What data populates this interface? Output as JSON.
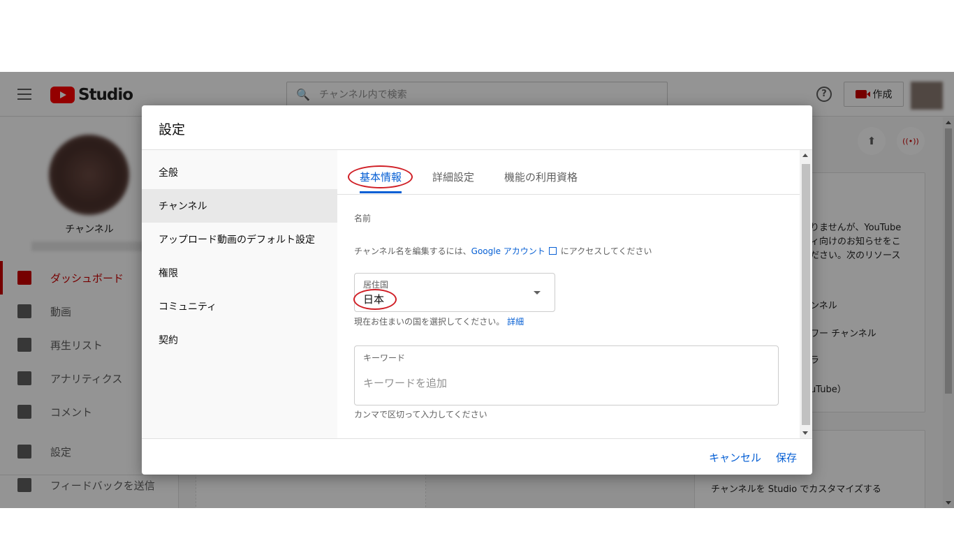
{
  "app": {
    "logo_text": "Studio",
    "search_placeholder": "チャンネル内で検索",
    "help_icon": "?",
    "create_label": "作成",
    "search_icon_glyph": "🔍"
  },
  "sidebar": {
    "channel_label": "チャンネル",
    "items": [
      {
        "label": "ダッシュボード",
        "icon": "dashboard-icon",
        "active": true
      },
      {
        "label": "動画",
        "icon": "video-icon"
      },
      {
        "label": "再生リスト",
        "icon": "playlist-icon"
      },
      {
        "label": "アナリティクス",
        "icon": "analytics-icon"
      },
      {
        "label": "コメント",
        "icon": "comment-icon"
      },
      {
        "label": "設定",
        "icon": "gear-icon"
      },
      {
        "label": "フィードバックを送信",
        "icon": "feedback-icon"
      }
    ]
  },
  "right_panel": {
    "upload_glyph": "⬆",
    "live_glyph": "((•))",
    "card_lines": [
      "りませんが、YouTube",
      "ィ向けのお知らせをこ",
      "ださい。次のリソース",
      "ンネル",
      "ワー チャンネル",
      "ラ",
      "uTube）"
    ],
    "bottom_card_text": "チャンネルを Studio でカスタマイズする"
  },
  "dialog": {
    "title": "設定",
    "nav": [
      "全般",
      "チャンネル",
      "アップロード動画のデフォルト設定",
      "権限",
      "コミュニティ",
      "契約"
    ],
    "tabs": [
      "基本情報",
      "詳細設定",
      "機能の利用資格"
    ],
    "name_label": "名前",
    "name_hint_prefix": "チャンネル名を編集するには、",
    "name_hint_link": "Google アカウント",
    "name_hint_suffix": "にアクセスしてください",
    "country_label": "居住国",
    "country_value": "日本",
    "country_hint": "現在お住まいの国を選択してください。",
    "country_hint_link": "詳細",
    "keyword_label": "キーワード",
    "keyword_placeholder": "キーワードを追加",
    "keyword_hint": "カンマで区切って入力してください",
    "cancel_label": "キャンセル",
    "save_label": "保存"
  },
  "colors": {
    "accent": "#065fd4",
    "brand": "#ff0000",
    "annotation": "#d01f26"
  }
}
